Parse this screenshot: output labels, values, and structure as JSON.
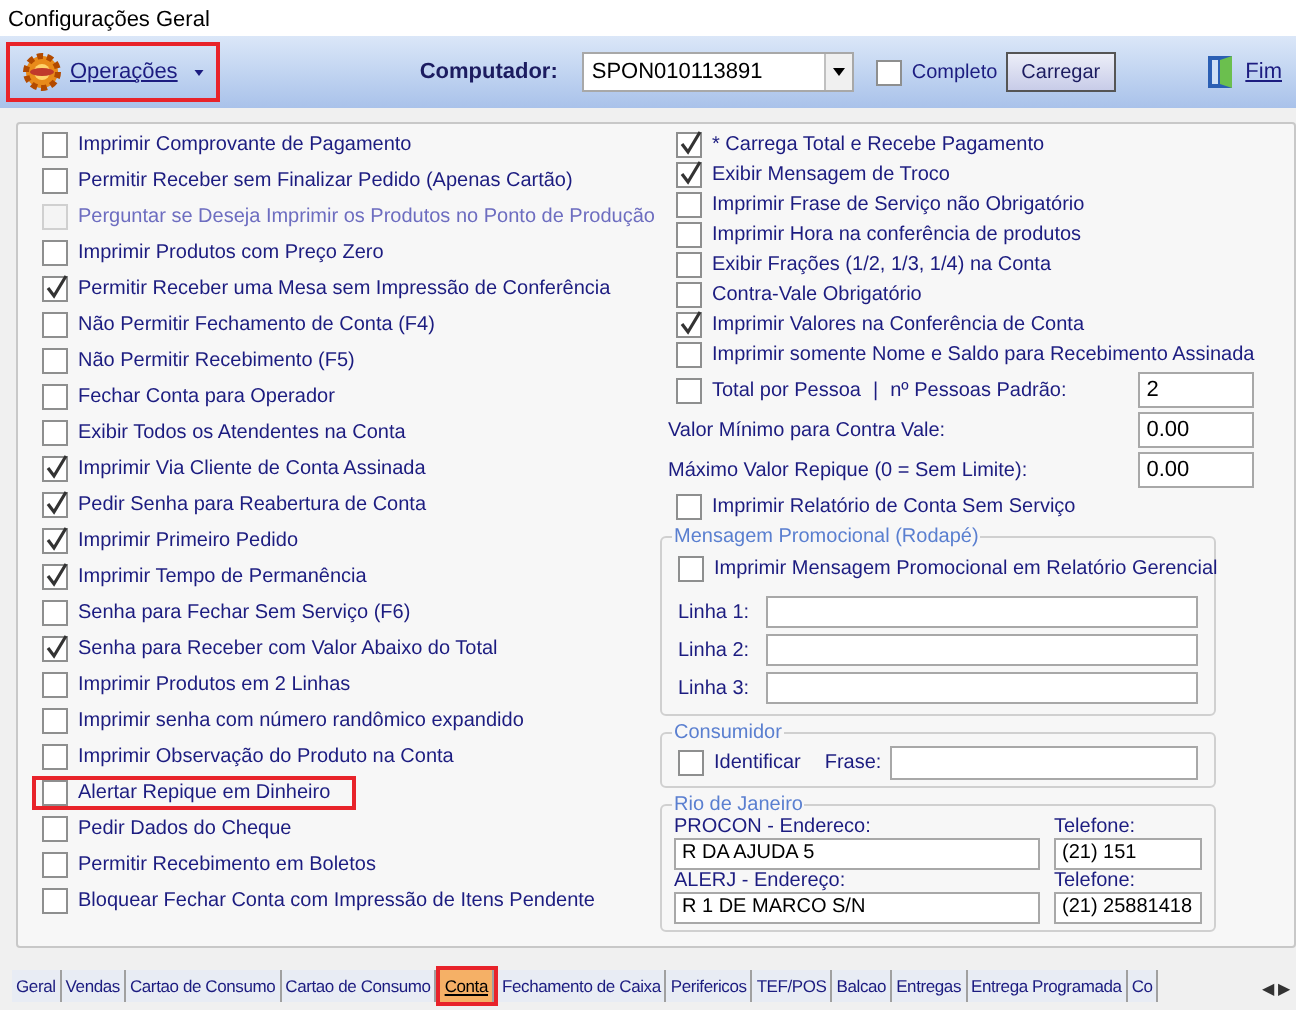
{
  "window": {
    "title": "Configurações Geral"
  },
  "toolbar": {
    "operations_menu": {
      "label": "Operações",
      "highlighted": true
    },
    "computer_label": "Computador:",
    "computer_value": "SPON010113891",
    "complete": {
      "label": "Completo",
      "checked": false
    },
    "load_button": "Carregar",
    "exit_button": "Fim"
  },
  "left_options": [
    {
      "label": "Imprimir Comprovante de Pagamento",
      "checked": false,
      "disabled": false,
      "highlighted": false
    },
    {
      "label": "Permitir Receber sem Finalizar Pedido (Apenas Cartão)",
      "checked": false,
      "disabled": false,
      "highlighted": false
    },
    {
      "label": "Perguntar se Deseja Imprimir os Produtos no Ponto de Produção",
      "checked": false,
      "disabled": true,
      "highlighted": false
    },
    {
      "label": "Imprimir Produtos com Preço Zero",
      "checked": false,
      "disabled": false,
      "highlighted": false
    },
    {
      "label": "Permitir Receber uma Mesa sem Impressão de Conferência",
      "checked": true,
      "disabled": false,
      "highlighted": false
    },
    {
      "label": "Não Permitir Fechamento de Conta (F4)",
      "checked": false,
      "disabled": false,
      "highlighted": false
    },
    {
      "label": "Não Permitir Recebimento (F5)",
      "checked": false,
      "disabled": false,
      "highlighted": false
    },
    {
      "label": "Fechar Conta para Operador",
      "checked": false,
      "disabled": false,
      "highlighted": false
    },
    {
      "label": "Exibir Todos os Atendentes na Conta",
      "checked": false,
      "disabled": false,
      "highlighted": false
    },
    {
      "label": "Imprimir Via Cliente de Conta Assinada",
      "checked": true,
      "disabled": false,
      "highlighted": false
    },
    {
      "label": "Pedir Senha para Reabertura de Conta",
      "checked": true,
      "disabled": false,
      "highlighted": false
    },
    {
      "label": "Imprimir Primeiro Pedido",
      "checked": true,
      "disabled": false,
      "highlighted": false
    },
    {
      "label": "Imprimir Tempo de Permanência",
      "checked": true,
      "disabled": false,
      "highlighted": false
    },
    {
      "label": "Senha para Fechar Sem Serviço (F6)",
      "checked": false,
      "disabled": false,
      "highlighted": false
    },
    {
      "label": "Senha para Receber com Valor Abaixo do Total",
      "checked": true,
      "disabled": false,
      "highlighted": false
    },
    {
      "label": "Imprimir Produtos em 2 Linhas",
      "checked": false,
      "disabled": false,
      "highlighted": false
    },
    {
      "label": "Imprimir senha com número randômico expandido",
      "checked": false,
      "disabled": false,
      "highlighted": false
    },
    {
      "label": "Imprimir Observação do Produto na Conta",
      "checked": false,
      "disabled": false,
      "highlighted": false
    },
    {
      "label": "Alertar Repique em Dinheiro",
      "checked": false,
      "disabled": false,
      "highlighted": true
    },
    {
      "label": "Pedir Dados do Cheque",
      "checked": false,
      "disabled": false,
      "highlighted": false
    },
    {
      "label": "Permitir Recebimento em Boletos",
      "checked": false,
      "disabled": false,
      "highlighted": false
    },
    {
      "label": "Bloquear Fechar Conta com Impressão de Itens Pendente",
      "checked": false,
      "disabled": false,
      "highlighted": false
    }
  ],
  "right_options": [
    {
      "label": "* Carrega Total e Recebe Pagamento",
      "checked": true
    },
    {
      "label": "Exibir Mensagem de Troco",
      "checked": true
    },
    {
      "label": "Imprimir Frase de Serviço não Obrigatório",
      "checked": false
    },
    {
      "label": "Imprimir Hora na conferência de produtos",
      "checked": false
    },
    {
      "label": "Exibir Frações (1/2, 1/3, 1/4) na Conta",
      "checked": false
    },
    {
      "label": "Contra-Vale Obrigatório",
      "checked": false
    },
    {
      "label": "Imprimir Valores na Conferência de Conta",
      "checked": true
    },
    {
      "label": "Imprimir somente Nome e Saldo para Recebimento Assinada",
      "checked": false
    }
  ],
  "per_person": {
    "label": "Total por Pessoa",
    "checked": false,
    "separator": "|",
    "default_label": "nº Pessoas Padrão:",
    "default_value": "2"
  },
  "value_fields": [
    {
      "label": "Valor Mínimo para Contra Vale:",
      "value": "0.00"
    },
    {
      "label": "Máximo Valor Repique (0 = Sem Limite):",
      "value": "0.00"
    }
  ],
  "report_option": {
    "label": "Imprimir Relatório de Conta Sem Serviço",
    "checked": false
  },
  "promo_group": {
    "title": "Mensagem Promocional (Rodapé)",
    "option": {
      "label": "Imprimir Mensagem Promocional em Relatório Gerencial",
      "checked": false
    },
    "lines": [
      {
        "label": "Linha 1:"
      },
      {
        "label": "Linha 2:"
      },
      {
        "label": "Linha 3:"
      }
    ]
  },
  "consumer_group": {
    "title": "Consumidor",
    "identify": {
      "label": "Identificar",
      "checked": false
    },
    "phrase_label": "Frase:"
  },
  "rj_group": {
    "title": "Rio de Janeiro",
    "entries": [
      {
        "address_label": "PROCON - Endereco:",
        "address": "R DA AJUDA 5",
        "phone_label": "Telefone:",
        "phone": "(21) 151"
      },
      {
        "address_label": "ALERJ - Endereço:",
        "address": "R 1 DE MARCO S/N",
        "phone_label": "Telefone:",
        "phone": "(21) 25881418"
      }
    ]
  },
  "tabs": [
    {
      "label": "Geral",
      "selected": false,
      "highlighted": false
    },
    {
      "label": "Vendas",
      "selected": false,
      "highlighted": false
    },
    {
      "label": "Cartao de Consumo",
      "selected": false,
      "highlighted": false
    },
    {
      "label": "Cartao de Consumo",
      "selected": false,
      "highlighted": false
    },
    {
      "label": "Conta",
      "selected": true,
      "highlighted": true
    },
    {
      "label": "Fechamento de Caixa",
      "selected": false,
      "highlighted": false
    },
    {
      "label": "Perifericos",
      "selected": false,
      "highlighted": false
    },
    {
      "label": "TEF/POS",
      "selected": false,
      "highlighted": false
    },
    {
      "label": "Balcao",
      "selected": false,
      "highlighted": false
    },
    {
      "label": "Entregas",
      "selected": false,
      "highlighted": false
    },
    {
      "label": "Entrega Programada",
      "selected": false,
      "highlighted": false
    },
    {
      "label": "Co",
      "selected": false,
      "highlighted": false
    }
  ],
  "tab_scroll": {
    "left": "◀",
    "right": "▶"
  }
}
